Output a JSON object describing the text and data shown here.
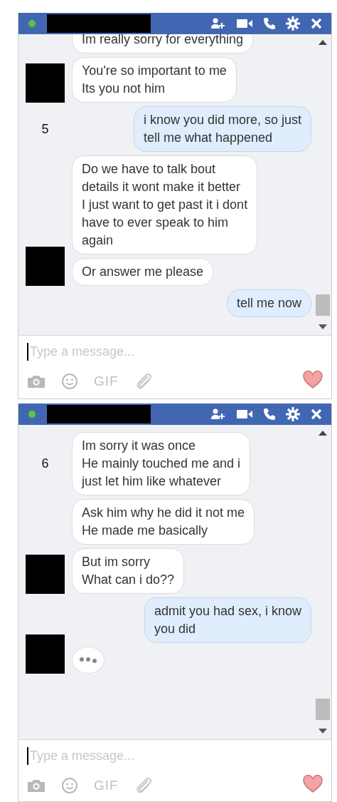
{
  "chats": [
    {
      "online": true,
      "placeholder": "Type a message...",
      "gif_label": "GIF",
      "messages": [
        {
          "kind": "incoming",
          "text": "Im really sorry for everything",
          "avatar": false
        },
        {
          "kind": "incoming",
          "text": "You're so important to me\nIts you not him",
          "avatar": true
        },
        {
          "kind": "outgoing",
          "text": "i know you did more, so just\ntell me what happened",
          "avatar": false,
          "note": "5"
        },
        {
          "kind": "incoming",
          "text": "Do we have to talk bout\ndetails it wont make it better\nI just want to get past it i dont\nhave to ever speak to him\nagain",
          "avatar": false
        },
        {
          "kind": "incoming",
          "text": "Or answer me please",
          "avatar": true
        },
        {
          "kind": "outgoing",
          "text": "tell me now",
          "avatar": false
        }
      ]
    },
    {
      "online": true,
      "placeholder": "Type a message...",
      "gif_label": "GIF",
      "messages": [
        {
          "kind": "incoming",
          "text": "Im sorry it was once\nHe mainly touched me and i\njust let him like whatever",
          "avatar": false,
          "note": "6"
        },
        {
          "kind": "incoming",
          "text": "Ask him why he did it not me\nHe made me basically",
          "avatar": false
        },
        {
          "kind": "incoming",
          "text": "But im sorry\nWhat can i do??",
          "avatar": true
        },
        {
          "kind": "outgoing",
          "text": "admit you had sex, i know\nyou did",
          "avatar": false
        },
        {
          "kind": "typing",
          "avatar": true
        }
      ]
    }
  ]
}
